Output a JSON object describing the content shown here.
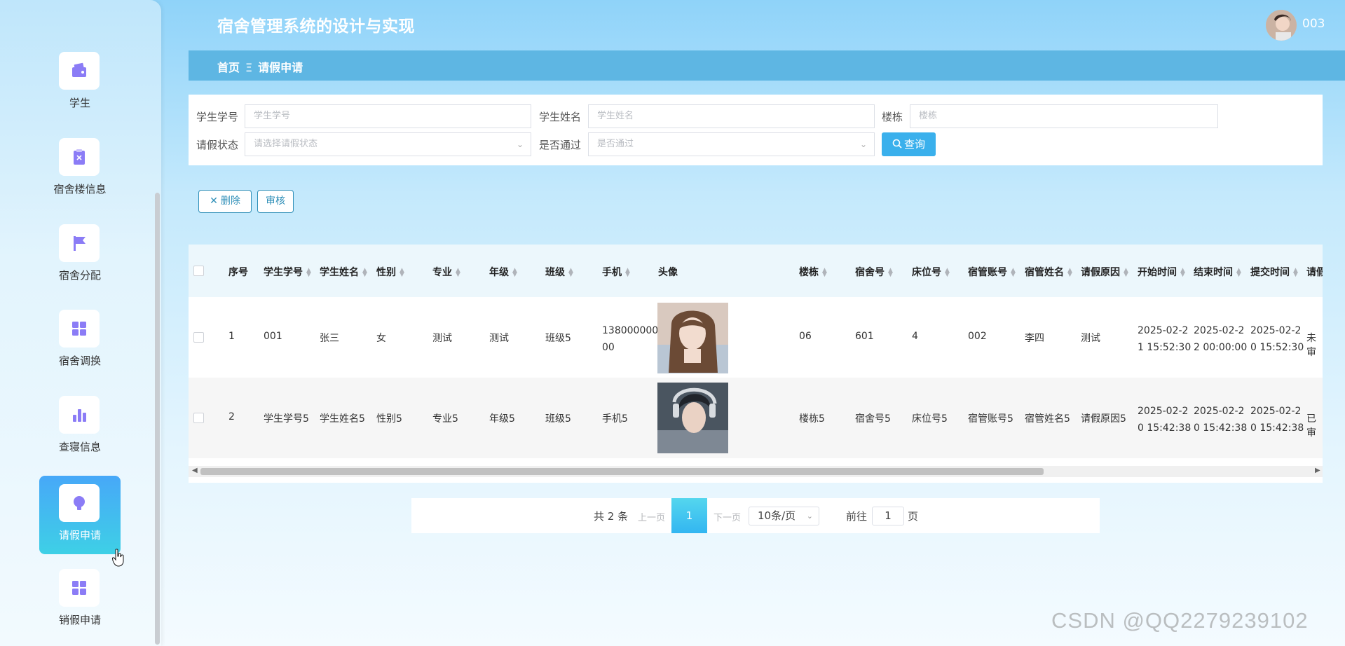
{
  "header": {
    "title": "宿舍管理系统的设计与实现",
    "username": "003"
  },
  "breadcrumb": {
    "home": "首页",
    "separator": "Ξ",
    "current": "请假申请"
  },
  "sidebar": {
    "items": [
      {
        "label": "学生",
        "icon": "wallet-icon"
      },
      {
        "label": "宿舍楼信息",
        "icon": "clipboard-x-icon"
      },
      {
        "label": "宿舍分配",
        "icon": "flag-icon"
      },
      {
        "label": "宿舍调换",
        "icon": "grid-icon"
      },
      {
        "label": "查寝信息",
        "icon": "bar-chart-icon"
      },
      {
        "label": "请假申请",
        "icon": "bulb-icon",
        "active": true
      },
      {
        "label": "销假申请",
        "icon": "grid-icon"
      }
    ]
  },
  "search": {
    "student_no": {
      "label": "学生学号",
      "placeholder": "学生学号"
    },
    "student_name": {
      "label": "学生姓名",
      "placeholder": "学生姓名"
    },
    "building": {
      "label": "楼栋",
      "placeholder": "楼栋"
    },
    "leave_status": {
      "label": "请假状态",
      "placeholder": "请选择请假状态"
    },
    "approved": {
      "label": "是否通过",
      "placeholder": "是否通过"
    },
    "query_label": "查询"
  },
  "actions": {
    "delete_label": "删除",
    "review_label": "审核"
  },
  "table": {
    "headers": {
      "index": "序号",
      "student_no": "学生学号",
      "student_name": "学生姓名",
      "gender": "性别",
      "major": "专业",
      "grade": "年级",
      "class": "班级",
      "phone": "手机",
      "avatar": "头像",
      "building": "楼栋",
      "room": "宿舍号",
      "bed": "床位号",
      "manager_account": "宿管账号",
      "manager_name": "宿管姓名",
      "reason": "请假原因",
      "start_time": "开始时间",
      "end_time": "结束时间",
      "submit_time": "提交时间",
      "status": "请假"
    },
    "rows": [
      {
        "index": "1",
        "student_no": "001",
        "student_name": "张三",
        "gender": "女",
        "major": "测试",
        "grade": "测试",
        "class": "班级5",
        "phone_l1": "138000000",
        "phone_l2": "00",
        "building": "06",
        "room": "601",
        "bed": "4",
        "manager_account": "002",
        "manager_name": "李四",
        "reason": "测试",
        "start_l1": "2025-02-2",
        "start_l2": "1 15:52:30",
        "end_l1": "2025-02-2",
        "end_l2": "2 00:00:00",
        "submit_l1": "2025-02-2",
        "submit_l2": "0 15:52:30",
        "status": "未审"
      },
      {
        "index": "2",
        "student_no": "学生学号5",
        "student_name": "学生姓名5",
        "gender": "性别5",
        "major": "专业5",
        "grade": "年级5",
        "class": "班级5",
        "phone_l1": "手机5",
        "phone_l2": "",
        "building": "楼栋5",
        "room": "宿舍号5",
        "bed": "床位号5",
        "manager_account": "宿管账号5",
        "manager_name": "宿管姓名5",
        "reason": "请假原因5",
        "start_l1": "2025-02-2",
        "start_l2": "0 15:42:38",
        "end_l1": "2025-02-2",
        "end_l2": "0 15:42:38",
        "submit_l1": "2025-02-2",
        "submit_l2": "0 15:42:38",
        "status": "已审"
      }
    ]
  },
  "pagination": {
    "total": "共 2 条",
    "prev": "上一页",
    "current": "1",
    "next": "下一页",
    "page_size": "10条/页",
    "goto_prefix": "前往",
    "goto_value": "1",
    "goto_suffix": "页"
  },
  "watermark": "CSDN @QQ2279239102",
  "colors": {
    "accent": "#3ab0ec",
    "active_menu_top": "#47a8f8",
    "active_menu_bottom": "#3ed0e6",
    "icon": "#8b7cf6"
  }
}
